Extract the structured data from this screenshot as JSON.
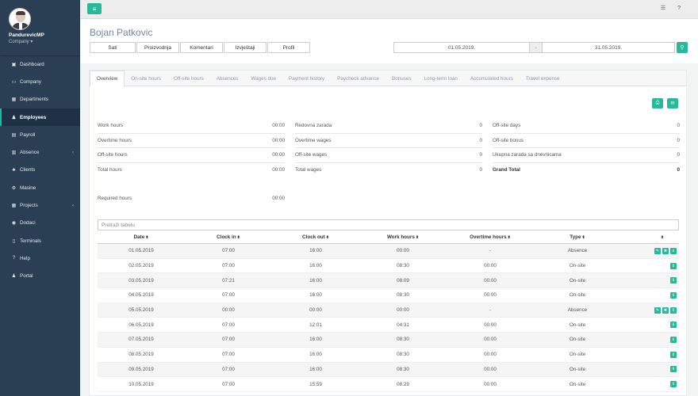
{
  "user": {
    "name": "PandurevicMP",
    "company": "Company ▾"
  },
  "sidebar": {
    "items": [
      {
        "label": "Dashboard",
        "icon": "▣",
        "icon_name": "dashboard-icon"
      },
      {
        "label": "Company",
        "icon": "▭",
        "icon_name": "company-icon"
      },
      {
        "label": "Departments",
        "icon": "▦",
        "icon_name": "departments-icon"
      },
      {
        "label": "Employees",
        "icon": "♟",
        "icon_name": "employees-icon",
        "active": true
      },
      {
        "label": "Payroll",
        "icon": "▤",
        "icon_name": "payroll-icon"
      },
      {
        "label": "Absence",
        "icon": "▥",
        "icon_name": "calendar-icon",
        "arrow": true
      },
      {
        "label": "Clients",
        "icon": "♣",
        "icon_name": "clients-icon"
      },
      {
        "label": "Masine",
        "icon": "⚙",
        "icon_name": "cogs-icon"
      },
      {
        "label": "Projects",
        "icon": "▦",
        "icon_name": "projects-icon",
        "arrow": true
      },
      {
        "label": "Dodaci",
        "icon": "◉",
        "icon_name": "dodaci-icon"
      },
      {
        "label": "Terminals",
        "icon": "▯",
        "icon_name": "terminals-icon"
      },
      {
        "label": "Help",
        "icon": "?",
        "icon_name": "help-icon"
      },
      {
        "label": "Portal",
        "icon": "♟",
        "icon_name": "portal-icon"
      }
    ]
  },
  "topbar": {
    "list_icon": "☰",
    "help_icon": "?"
  },
  "header": {
    "title": "Bojan Patkovic",
    "buttons": [
      "Sati",
      "Proizvodnja",
      "Komentari",
      "Izvještaji",
      "Profil"
    ],
    "date_from": "01.05.2019.",
    "date_sep": "-",
    "date_to": "31.05.2019."
  },
  "tabs": [
    "Overview",
    "On-site hours",
    "Off-site hours",
    "Absences",
    "Wages due",
    "Payment history",
    "Paycheck advance",
    "Bonuses",
    "Long-term loan",
    "Accumulated hours",
    "Travel expense"
  ],
  "summary": {
    "col1": [
      {
        "label": "Work hours",
        "value": "00:00"
      },
      {
        "label": "Overtime hours",
        "value": "00:00"
      },
      {
        "label": "Off-site hours",
        "value": "00:00"
      },
      {
        "label": "Total hours",
        "value": "00:00"
      }
    ],
    "col2": [
      {
        "label": "Redovna zarada",
        "value": "0"
      },
      {
        "label": "Overtime wages",
        "value": "0"
      },
      {
        "label": "Off-site wages",
        "value": "0"
      },
      {
        "label": "Total wages",
        "value": "0"
      }
    ],
    "col3": [
      {
        "label": "Off-site days",
        "value": "0"
      },
      {
        "label": "Off-site bonus",
        "value": "0"
      },
      {
        "label": "Ukupna zarada sa dnevnicama",
        "value": "0"
      },
      {
        "label": "Grand Total",
        "value": "0"
      }
    ],
    "required_label": "Required hours",
    "required_value": "00:00"
  },
  "table": {
    "search_placeholder": "Pretraži tabelu",
    "headers": [
      "Date",
      "Clock in",
      "Clock out",
      "Work hours",
      "Overtime hours",
      "Type",
      ""
    ],
    "rows": [
      {
        "date": "01.05.2019",
        "in": "07:00",
        "out": "16:00",
        "work": "00:00",
        "ot": "-",
        "type": "Absence",
        "full": true
      },
      {
        "date": "02.05.2019",
        "in": "07:00",
        "out": "16:00",
        "work": "08:30",
        "ot": "00:00",
        "type": "On-site"
      },
      {
        "date": "03.05.2019",
        "in": "07:21",
        "out": "16:00",
        "work": "08:09",
        "ot": "00:00",
        "type": "On-site"
      },
      {
        "date": "04.05.2019",
        "in": "07:00",
        "out": "16:00",
        "work": "08:30",
        "ot": "00:00",
        "type": "On-site"
      },
      {
        "date": "05.05.2019",
        "in": "00:00",
        "out": "00:00",
        "work": "00:00",
        "ot": "-",
        "type": "Absence",
        "full": true
      },
      {
        "date": "06.05.2019",
        "in": "07:00",
        "out": "12:01",
        "work": "04:31",
        "ot": "00:00",
        "type": "On-site"
      },
      {
        "date": "07.05.2019",
        "in": "07:00",
        "out": "16:00",
        "work": "08:30",
        "ot": "00:00",
        "type": "On-site"
      },
      {
        "date": "08.05.2019",
        "in": "07:00",
        "out": "16:00",
        "work": "08:30",
        "ot": "00:00",
        "type": "On-site"
      },
      {
        "date": "09.05.2019",
        "in": "07:00",
        "out": "16:00",
        "work": "08:30",
        "ot": "00:00",
        "type": "On-site"
      },
      {
        "date": "10.05.2019",
        "in": "07:00",
        "out": "15:59",
        "work": "08:29",
        "ot": "00:00",
        "type": "On-site"
      }
    ]
  },
  "colors": {
    "accent": "#26b99a",
    "sidebar": "#2a3f54"
  }
}
